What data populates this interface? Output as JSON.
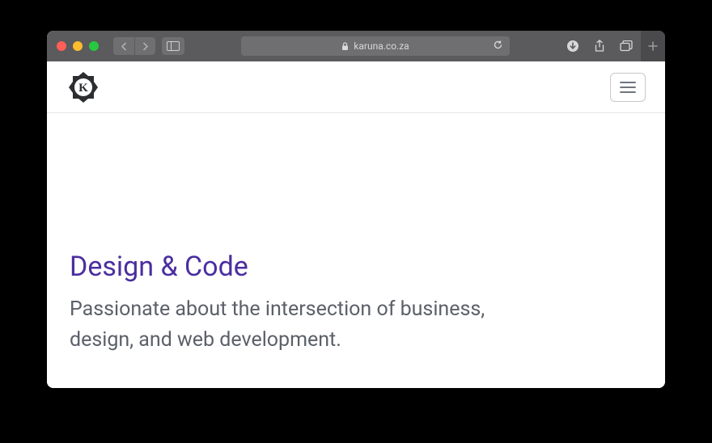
{
  "browser": {
    "url_display": "karuna.co.za"
  },
  "page": {
    "heading": "Design & Code",
    "subheading": "Passionate about the intersection of business, design, and web development."
  }
}
